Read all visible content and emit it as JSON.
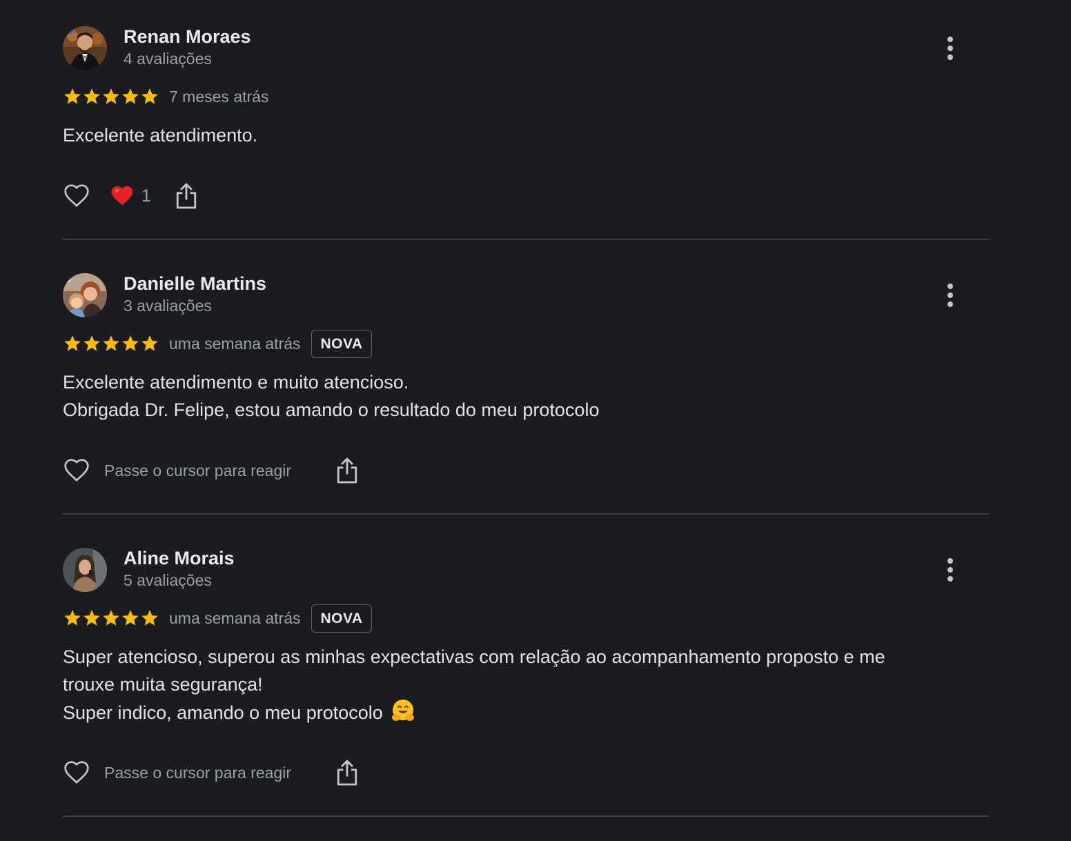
{
  "reviews": [
    {
      "author": "Renan Moraes",
      "review_count": "4 avaliações",
      "rating": 5,
      "when": "7 meses atrás",
      "badge": "",
      "text_lines": [
        "Excelente atendimento."
      ],
      "reaction_count": "1",
      "hover_hint": ""
    },
    {
      "author": "Danielle Martins",
      "review_count": "3 avaliações",
      "rating": 5,
      "when": "uma semana atrás",
      "badge": "NOVA",
      "text_lines": [
        "Excelente atendimento e muito atencioso.",
        "Obrigada Dr. Felipe, estou amando o resultado do meu protocolo"
      ],
      "reaction_count": "",
      "hover_hint": "Passe o cursor para reagir"
    },
    {
      "author": "Aline Morais",
      "review_count": "5 avaliações",
      "rating": 5,
      "when": "uma semana atrás",
      "badge": "NOVA",
      "text_lines": [
        "Super atencioso, superou as minhas expectativas com relação ao acompanhamento proposto e me",
        "trouxe muita segurança!",
        "Super indico, amando o meu protocolo"
      ],
      "reaction_count": "",
      "hover_hint": "Passe o cursor para reagir"
    }
  ],
  "colors": {
    "background": "#1b1c1f",
    "star": "#fbbc04",
    "heart_reaction": "#e8202a",
    "divider": "#3c4043"
  },
  "icons": [
    "avatar",
    "star-icon",
    "more-vert-icon",
    "heart-outline-icon",
    "heart-reaction-icon",
    "share-icon",
    "hugging-face-emoji"
  ]
}
